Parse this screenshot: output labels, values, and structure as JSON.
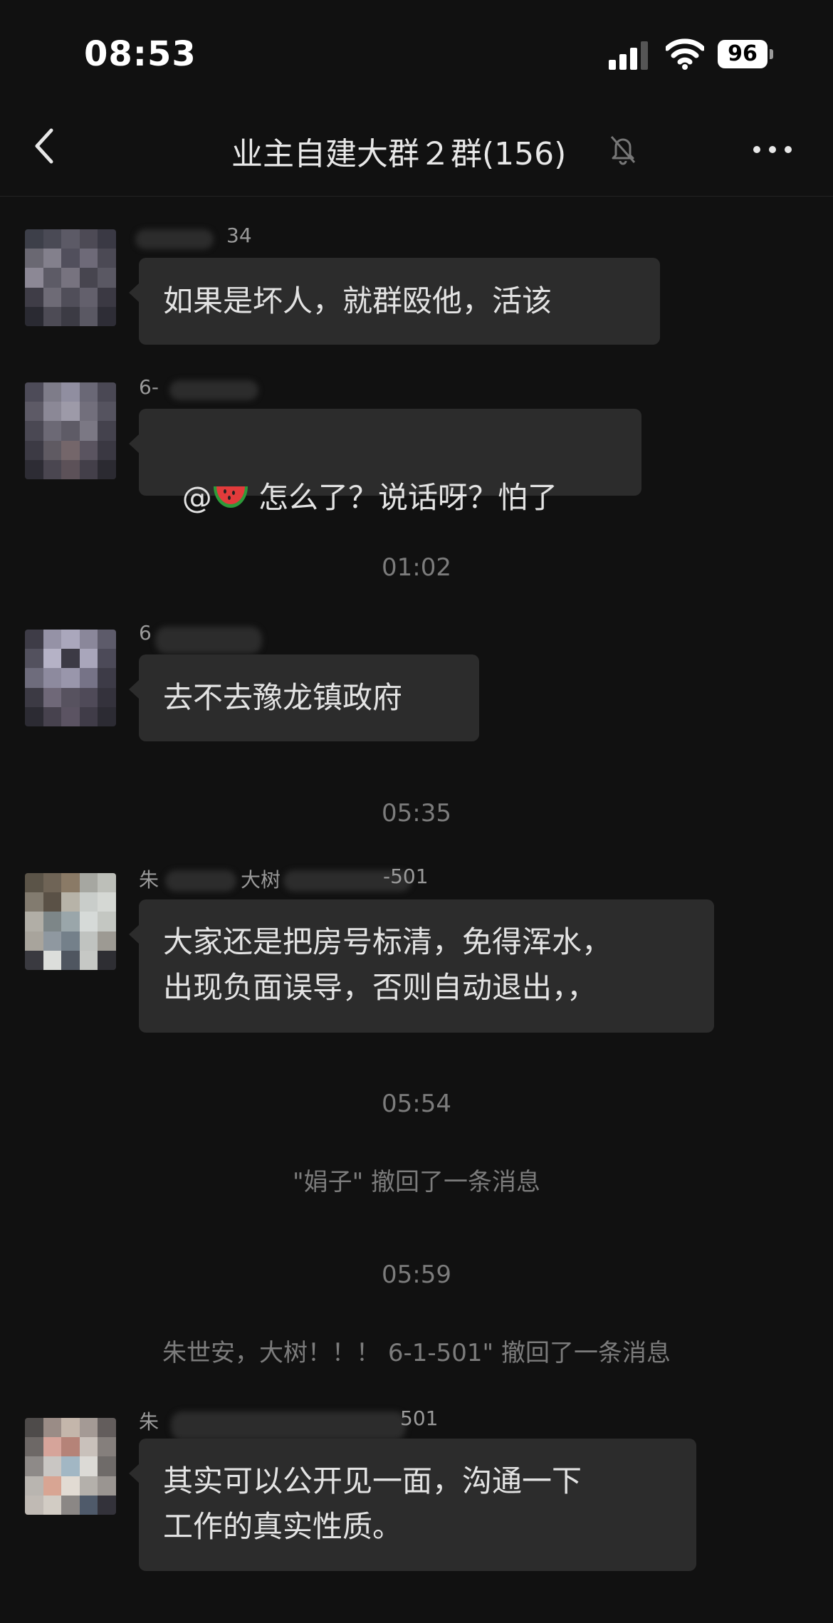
{
  "status": {
    "time": "08:53",
    "battery": "96"
  },
  "header": {
    "title": "业主自建大群２群(156)"
  },
  "messages": [
    {
      "sender": "34",
      "text": "如果是坏人，就群殴他，活该"
    },
    {
      "sender": "6-",
      "mention": "@",
      "emoji": "watermelon",
      "text": " 怎么了？说话呀？怕了"
    },
    {
      "sender": "6",
      "text": "去不去豫龙镇政府"
    },
    {
      "sender": "朱",
      "sender_mid": "大树",
      "sender_end": "-501",
      "text": "大家还是把房号标清，免得浑水，\n出现负面误导，否则自动退出，，"
    },
    {
      "sender": "朱",
      "sender_end": "501",
      "text": "其实可以公开见一面，沟通一下\n工作的真实性质。"
    }
  ],
  "timestamps": [
    "01:02",
    "05:35",
    "05:54",
    "05:59"
  ],
  "notices": [
    "\"娟子\" 撤回了一条消息",
    "朱世安，大树！！！ 6-1-501\" 撤回了一条消息"
  ],
  "colors": {
    "background": "#111111",
    "bubble": "#2c2c2c",
    "text": "#e3e3e3",
    "muted": "#7c7c7c"
  },
  "icons": [
    "back-arrow-icon",
    "mute-bell-icon",
    "more-dots-icon",
    "signal-icon",
    "wifi-icon",
    "battery-icon",
    "watermelon-emoji-icon"
  ]
}
